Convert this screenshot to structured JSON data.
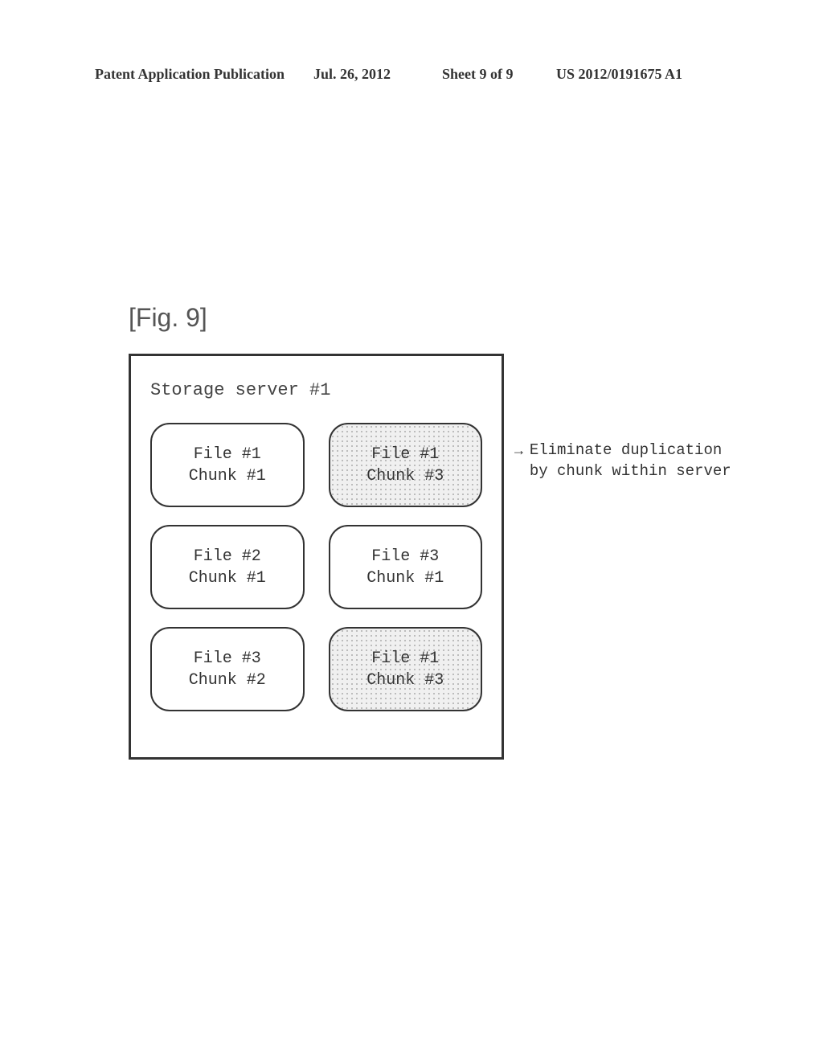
{
  "header": {
    "left": "Patent Application Publication",
    "date": "Jul. 26, 2012",
    "sheet": "Sheet 9 of 9",
    "pubnum": "US 2012/0191675 A1"
  },
  "figure_label": "[Fig. 9]",
  "server": {
    "title": "Storage server #1",
    "chunks": [
      {
        "file": "File #1",
        "chunk": "Chunk #1",
        "shaded": false
      },
      {
        "file": "File #1",
        "chunk": "Chunk #3",
        "shaded": true
      },
      {
        "file": "File #2",
        "chunk": "Chunk #1",
        "shaded": false
      },
      {
        "file": "File #3",
        "chunk": "Chunk #1",
        "shaded": false
      },
      {
        "file": "File #3",
        "chunk": "Chunk #2",
        "shaded": false
      },
      {
        "file": "File #1",
        "chunk": "Chunk #3",
        "shaded": true
      }
    ]
  },
  "annotation": {
    "line1": "Eliminate duplication",
    "line2": "by chunk within server"
  }
}
